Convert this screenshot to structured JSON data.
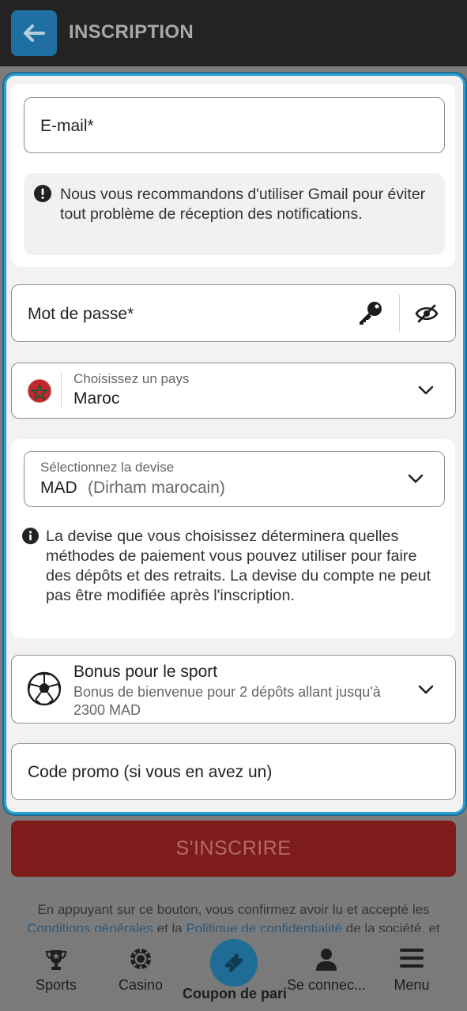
{
  "header": {
    "title": "INSCRIPTION"
  },
  "email": {
    "label": "E-mail*",
    "notice": "Nous vous recommandons d'utiliser Gmail pour éviter tout problème de réception des notifications."
  },
  "password": {
    "label": "Mot de passe*"
  },
  "country": {
    "label": "Choisissez un pays",
    "value": "Maroc"
  },
  "currency": {
    "label": "Sélectionnez la devise",
    "code": "MAD",
    "name": "(Dirham marocain)",
    "notice": "La devise que vous choisissez déterminera quelles méthodes de paiement vous pouvez utiliser pour faire des dépôts et des retraits. La devise du compte ne peut pas être modifiée après l'inscription."
  },
  "bonus": {
    "title": "Bonus pour le sport",
    "subtitle": "Bonus de bienvenue pour 2 dépôts allant jusqu'à 2300 MAD"
  },
  "promo": {
    "placeholder": "Code promo (si vous en avez un)"
  },
  "submit": {
    "label": "S'INSCRIRE"
  },
  "terms": {
    "line1": "En appuyant sur ce bouton, vous confirmez avoir lu et accepté les",
    "link1": "Conditions générales",
    "and": " et la ",
    "link2": "Politique de confidentialité",
    "rest": " de la société, et"
  },
  "nav": {
    "sports": "Sports",
    "casino": "Casino",
    "coupon": "Coupon de pari",
    "login": "Se connec...",
    "menu": "Menu"
  },
  "colors": {
    "accent": "#2a9fd6",
    "submit": "#7e1c1c",
    "header": "#232323"
  }
}
